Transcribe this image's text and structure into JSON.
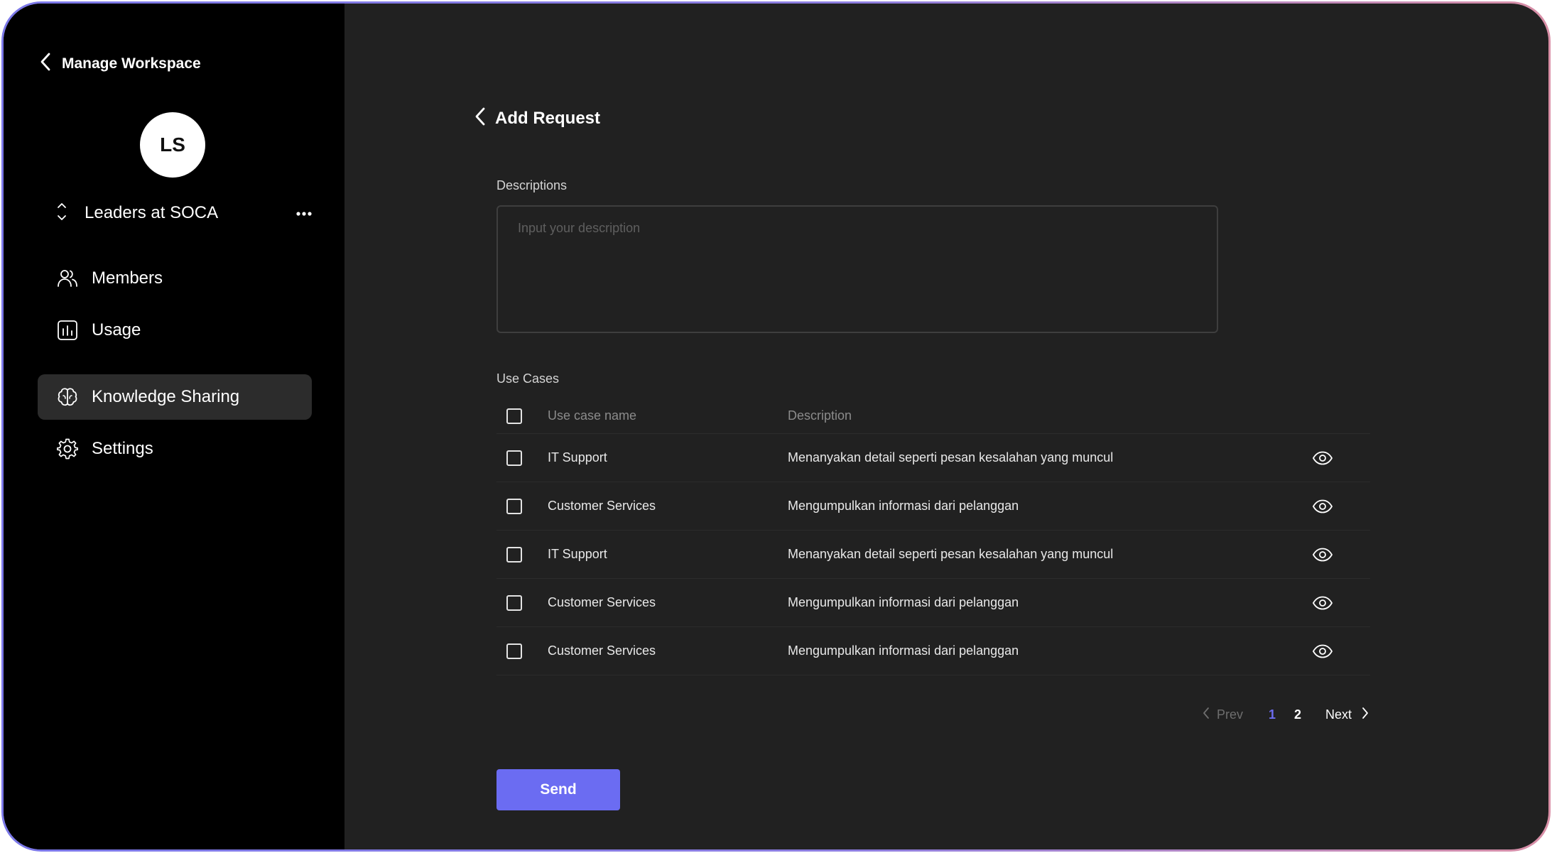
{
  "sidebar": {
    "back_title": "Manage Workspace",
    "avatar_initials": "LS",
    "workspace_name": "Leaders at SOCA",
    "items": [
      {
        "label": "Members",
        "icon": "members-icon",
        "active": false
      },
      {
        "label": "Usage",
        "icon": "usage-icon",
        "active": false
      },
      {
        "label": "Knowledge Sharing",
        "icon": "brain-icon",
        "active": true
      },
      {
        "label": "Settings",
        "icon": "gear-icon",
        "active": false
      }
    ]
  },
  "main": {
    "title": "Add Request",
    "descriptions_label": "Descriptions",
    "descriptions_placeholder": "Input your description",
    "descriptions_value": "",
    "use_cases_label": "Use Cases",
    "columns": {
      "name": "Use case name",
      "description": "Description"
    },
    "rows": [
      {
        "name": "IT Support",
        "description": "Menanyakan detail seperti pesan kesalahan yang muncul",
        "checked": false
      },
      {
        "name": "Customer Services",
        "description": "Mengumpulkan informasi dari pelanggan",
        "checked": false
      },
      {
        "name": "IT Support",
        "description": "Menanyakan detail seperti pesan kesalahan yang muncul",
        "checked": false
      },
      {
        "name": "Customer Services",
        "description": "Mengumpulkan informasi dari pelanggan",
        "checked": false
      },
      {
        "name": "Customer Services",
        "description": "Mengumpulkan informasi dari pelanggan",
        "checked": false
      }
    ],
    "pagination": {
      "prev_label": "Prev",
      "next_label": "Next",
      "pages": [
        "1",
        "2"
      ],
      "current_page": "1"
    },
    "send_label": "Send"
  },
  "colors": {
    "accent": "#6b6cf2",
    "sidebar_bg": "#000000",
    "main_bg": "#212121",
    "active_nav_bg": "#2c2c2c"
  }
}
